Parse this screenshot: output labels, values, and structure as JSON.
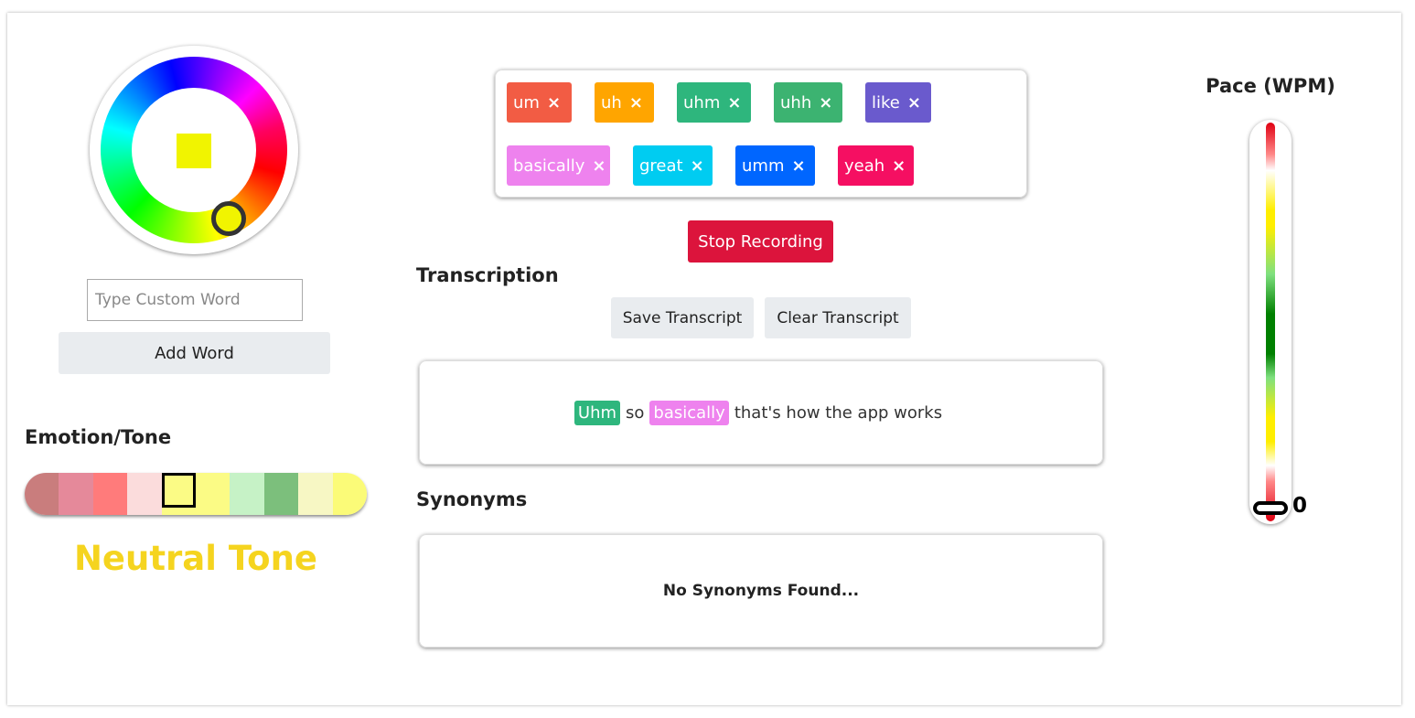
{
  "color_picker": {
    "selected_color": "#f1f400"
  },
  "custom_word": {
    "placeholder": "Type Custom Word",
    "value": "",
    "add_label": "Add Word"
  },
  "emotion": {
    "label": "Emotion/Tone",
    "segments": [
      "#c97d7d",
      "#e5899a",
      "#ff7b7b",
      "#fbdcdc",
      "#fbfb85",
      "#fbfb85",
      "#c6f2c6",
      "#7cbf7c",
      "#f7f7c4",
      "#fbfb78"
    ],
    "selected_index": 4,
    "tone_text": "Neutral Tone",
    "tone_color": "#f5d41f"
  },
  "filler_tags": [
    {
      "label": "um",
      "color": "#f25c44"
    },
    {
      "label": "uh",
      "color": "#ffa500"
    },
    {
      "label": "uhm",
      "color": "#2eb67d"
    },
    {
      "label": "uhh",
      "color": "#3cb371"
    },
    {
      "label": "like",
      "color": "#6a5acd"
    },
    {
      "label": "basically",
      "color": "#ee82ee"
    },
    {
      "label": "great",
      "color": "#00ccf1"
    },
    {
      "label": "umm",
      "color": "#0066ff"
    },
    {
      "label": "yeah",
      "color": "#f50f62"
    }
  ],
  "remove_glyph": "×",
  "recording": {
    "stop_label": "Stop Recording",
    "stop_color": "#dc143c"
  },
  "transcription": {
    "heading": "Transcription",
    "save_label": "Save Transcript",
    "clear_label": "Clear Transcript",
    "segments": [
      {
        "text": "Uhm",
        "highlight": "#2eb67d"
      },
      {
        "text": "so",
        "highlight": null
      },
      {
        "text": "basically",
        "highlight": "#ee82ee"
      },
      {
        "text": "that's how the app works",
        "highlight": null
      }
    ]
  },
  "synonyms": {
    "heading": "Synonyms",
    "empty_text": "No Synonyms Found..."
  },
  "pace": {
    "title": "Pace (WPM)",
    "value": "0",
    "fraction": 0
  }
}
